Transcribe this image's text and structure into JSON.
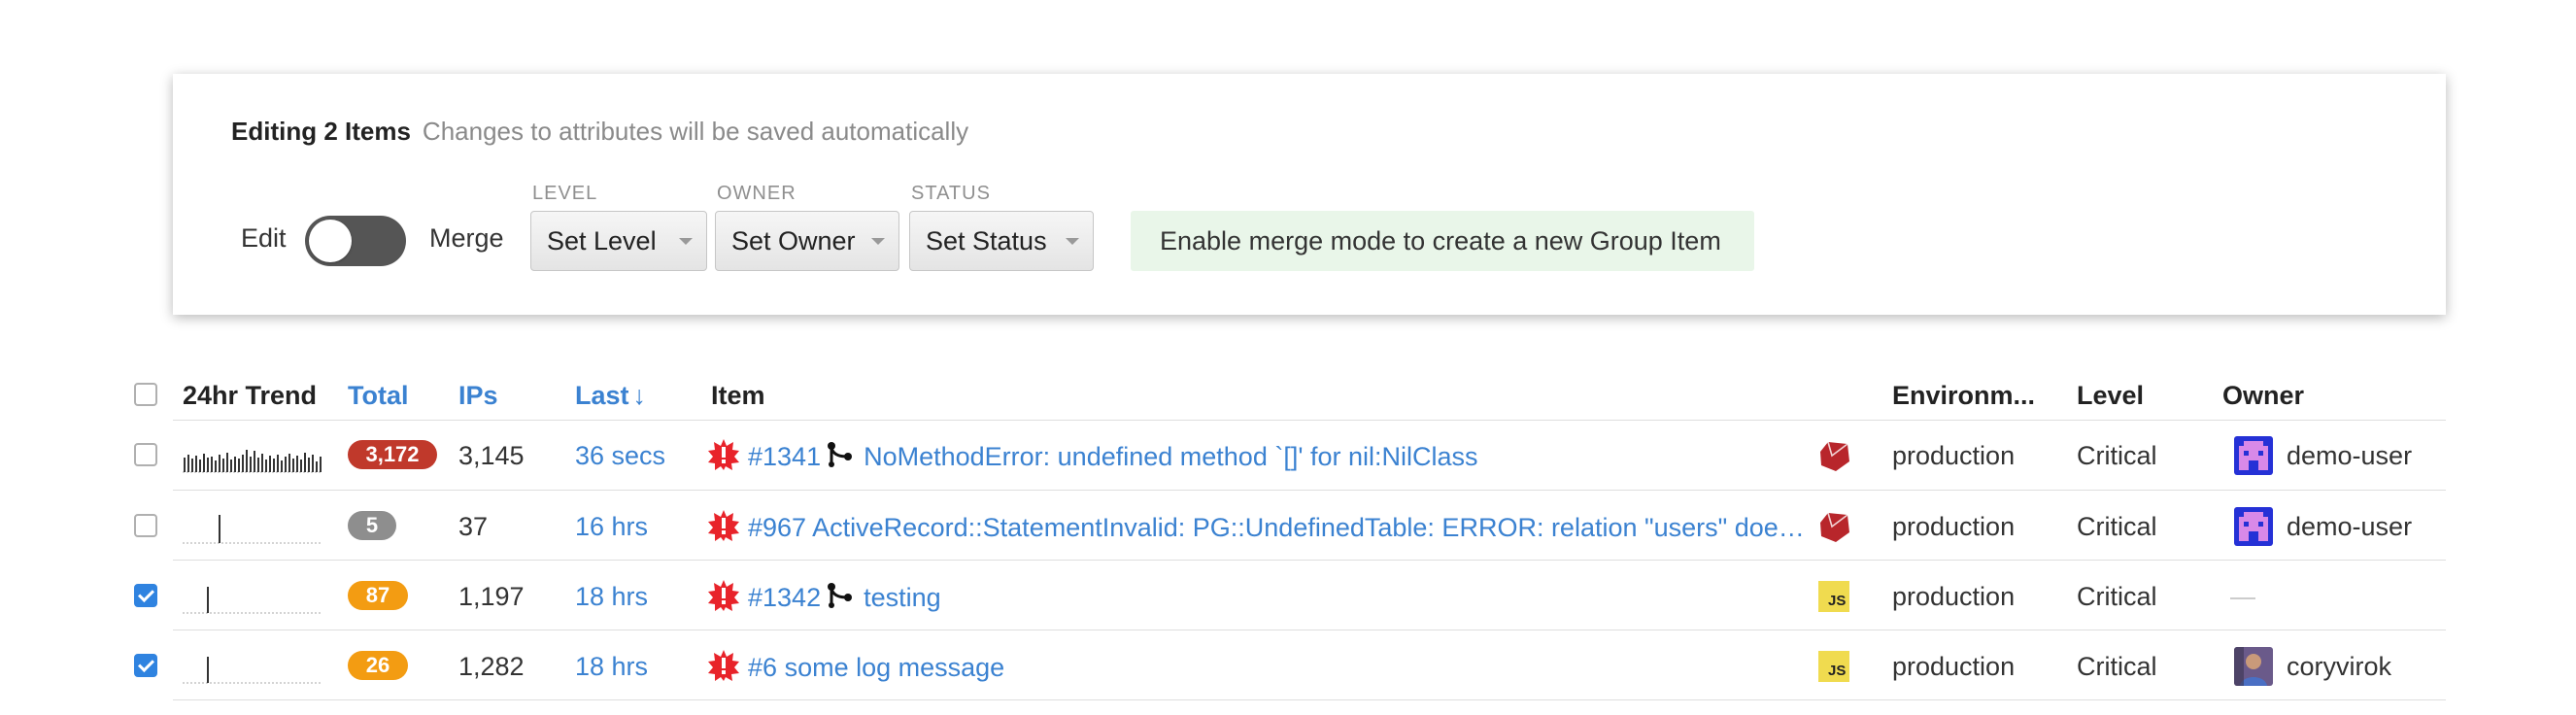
{
  "panel": {
    "title": "Editing 2 Items",
    "note": "Changes to attributes will be saved automatically",
    "edit_label": "Edit",
    "merge_label": "Merge",
    "level": {
      "label": "LEVEL",
      "button": "Set Level"
    },
    "owner": {
      "label": "OWNER",
      "button": "Set Owner"
    },
    "status": {
      "label": "STATUS",
      "button": "Set Status"
    },
    "merge_hint": "Enable merge mode to create a new Group Item"
  },
  "table": {
    "headers": {
      "trend": "24hr Trend",
      "total": "Total",
      "ips": "IPs",
      "last": "Last",
      "last_sort_icon": "↓",
      "item": "Item",
      "environment": "Environm...",
      "level": "Level",
      "owner": "Owner"
    },
    "rows": [
      {
        "checked": false,
        "total": "3,172",
        "total_color": "#c0392b",
        "ips": "3,145",
        "last": "36 secs",
        "item_id": "#1341",
        "merged": true,
        "title": "NoMethodError: undefined method `[]' for nil:NilClass",
        "language": "ruby",
        "environment": "production",
        "level": "Critical",
        "owner": "demo-user",
        "owner_avatar": "pixel-avatar"
      },
      {
        "checked": false,
        "total": "5",
        "total_color": "#8e8e8e",
        "ips": "37",
        "last": "16 hrs",
        "item_id": "#967",
        "merged": false,
        "title": "ActiveRecord::StatementInvalid: PG::UndefinedTable: ERROR: relation \"users\" does not exist",
        "language": "ruby",
        "environment": "production",
        "level": "Critical",
        "owner": "demo-user",
        "owner_avatar": "pixel-avatar"
      },
      {
        "checked": true,
        "total": "87",
        "total_color": "#f39c12",
        "ips": "1,197",
        "last": "18 hrs",
        "item_id": "#1342",
        "merged": true,
        "title": "testing",
        "language": "javascript",
        "language_badge": "JS",
        "environment": "production",
        "level": "Critical",
        "owner": "",
        "owner_avatar": "none"
      },
      {
        "checked": true,
        "total": "26",
        "total_color": "#f39c12",
        "ips": "1,282",
        "last": "18 hrs",
        "item_id": "#6",
        "merged": false,
        "title": "some log message",
        "language": "javascript",
        "language_badge": "JS",
        "environment": "production",
        "level": "Critical",
        "owner": "coryvirok",
        "owner_avatar": "photo-avatar"
      }
    ]
  },
  "colors": {
    "accent": "#3b82d1",
    "error_icon": "#e8232a",
    "ruby": "#b8262b",
    "js": "#f0db4f"
  }
}
